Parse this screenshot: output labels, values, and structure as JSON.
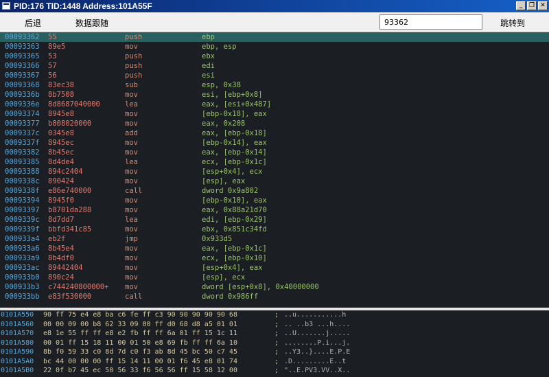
{
  "window": {
    "title": "PID:176  TID:1448  Address:101A55F"
  },
  "toolbar": {
    "back_label": "后退",
    "trace_label": "数据跟随",
    "address_value": "93362",
    "goto_label": "跳转到"
  },
  "disassembly": [
    {
      "addr": "00093362",
      "bytes": "55",
      "mnemonic": "push",
      "operands": "ebp"
    },
    {
      "addr": "00093363",
      "bytes": "89e5",
      "mnemonic": "mov",
      "operands": "ebp, esp"
    },
    {
      "addr": "00093365",
      "bytes": "53",
      "mnemonic": "push",
      "operands": "ebx"
    },
    {
      "addr": "00093366",
      "bytes": "57",
      "mnemonic": "push",
      "operands": "edi"
    },
    {
      "addr": "00093367",
      "bytes": "56",
      "mnemonic": "push",
      "operands": "esi"
    },
    {
      "addr": "00093368",
      "bytes": "83ec38",
      "mnemonic": "sub",
      "operands": "esp, 0x38"
    },
    {
      "addr": "0009336b",
      "bytes": "8b7508",
      "mnemonic": "mov",
      "operands": "esi, [ebp+0x8]"
    },
    {
      "addr": "0009336e",
      "bytes": "8d8687040000",
      "mnemonic": "lea",
      "operands": "eax, [esi+0x487]"
    },
    {
      "addr": "00093374",
      "bytes": "8945e8",
      "mnemonic": "mov",
      "operands": "[ebp-0x18], eax"
    },
    {
      "addr": "00093377",
      "bytes": "b808020000",
      "mnemonic": "mov",
      "operands": "eax, 0x208"
    },
    {
      "addr": "0009337c",
      "bytes": "0345e8",
      "mnemonic": "add",
      "operands": "eax, [ebp-0x18]"
    },
    {
      "addr": "0009337f",
      "bytes": "8945ec",
      "mnemonic": "mov",
      "operands": "[ebp-0x14], eax"
    },
    {
      "addr": "00093382",
      "bytes": "8b45ec",
      "mnemonic": "mov",
      "operands": "eax, [ebp-0x14]"
    },
    {
      "addr": "00093385",
      "bytes": "8d4de4",
      "mnemonic": "lea",
      "operands": "ecx, [ebp-0x1c]"
    },
    {
      "addr": "00093388",
      "bytes": "894c2404",
      "mnemonic": "mov",
      "operands": "[esp+0x4], ecx"
    },
    {
      "addr": "0009338c",
      "bytes": "890424",
      "mnemonic": "mov",
      "operands": "[esp], eax"
    },
    {
      "addr": "0009338f",
      "bytes": "e86e740000",
      "mnemonic": "call",
      "operands": "dword 0x9a802"
    },
    {
      "addr": "00093394",
      "bytes": "8945f0",
      "mnemonic": "mov",
      "operands": "[ebp-0x10], eax"
    },
    {
      "addr": "00093397",
      "bytes": "b8701da288",
      "mnemonic": "mov",
      "operands": "eax, 0x88a21d70"
    },
    {
      "addr": "0009339c",
      "bytes": "8d7dd7",
      "mnemonic": "lea",
      "operands": "edi, [ebp-0x29]"
    },
    {
      "addr": "0009339f",
      "bytes": "bbfd341c85",
      "mnemonic": "mov",
      "operands": "ebx, 0x851c34fd"
    },
    {
      "addr": "000933a4",
      "bytes": "eb2f",
      "mnemonic": "jmp",
      "operands": "0x933d5"
    },
    {
      "addr": "000933a6",
      "bytes": "8b45e4",
      "mnemonic": "mov",
      "operands": "eax, [ebp-0x1c]"
    },
    {
      "addr": "000933a9",
      "bytes": "8b4df0",
      "mnemonic": "mov",
      "operands": "ecx, [ebp-0x10]"
    },
    {
      "addr": "000933ac",
      "bytes": "89442404",
      "mnemonic": "mov",
      "operands": "[esp+0x4], eax"
    },
    {
      "addr": "000933b0",
      "bytes": "890c24",
      "mnemonic": "mov",
      "operands": "[esp], ecx"
    },
    {
      "addr": "000933b3",
      "bytes": "c744240800000+",
      "mnemonic": "mov",
      "operands": "dword [esp+0x8], 0x40000000"
    },
    {
      "addr": "000933bb",
      "bytes": "e83f530000",
      "mnemonic": "call",
      "operands": "dword 0x986ff"
    }
  ],
  "hexdump": [
    {
      "addr": "0101A550",
      "bytes": "90 ff 75 e4 e8 ba c6 fe ff c3 90 90 90 90 90 68",
      "ascii": "..u...........h"
    },
    {
      "addr": "0101A560",
      "bytes": "00 00 09 00 b8 62 33 09 00 ff d0 68 d8 a5 01 01",
      "ascii": ".. ..b3 ...h...."
    },
    {
      "addr": "0101A570",
      "bytes": "e8 1e 55 ff ff e8 e2 fb ff ff 6a 01 ff 15 1c 11",
      "ascii": "..U.......j....."
    },
    {
      "addr": "0101A580",
      "bytes": "00 01 ff 15 18 11 00 01 50 e8 69 fb ff ff 6a 10",
      "ascii": "........P.i...j."
    },
    {
      "addr": "0101A590",
      "bytes": "8b f0 59 33 c0 8d 7d c0 f3 ab 8d 45 bc 50 c7 45",
      "ascii": "..Y3..}....E.P.E"
    },
    {
      "addr": "0101A5A0",
      "bytes": "bc 44 00 00 00 ff 15 14 11 00 01 f6 45 e8 01 74",
      "ascii": ".D.........E..t"
    },
    {
      "addr": "0101A5B0",
      "bytes": "22 0f b7 45 ec 50 56 33 f6 56 56 ff 15 58 12 00",
      "ascii": "\"..E.PV3.VV..X.."
    }
  ]
}
